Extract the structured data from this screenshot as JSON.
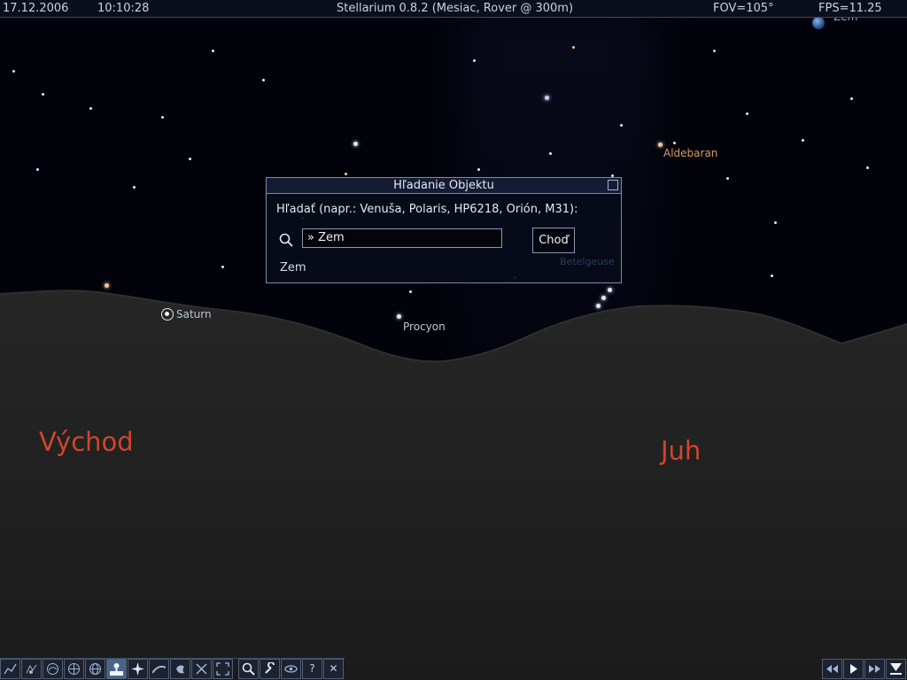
{
  "topbar": {
    "date": "17.12.2006",
    "time": "10:10:28",
    "title": "Stellarium 0.8.2 (Mesiac, Rover @ 300m)",
    "fov": "FOV=105°",
    "fps": "FPS=11.25"
  },
  "sky_labels": {
    "zem": "Zem",
    "aldebaran": "Aldebaran",
    "saturn": "Saturn",
    "procyon": "Procyon",
    "faded": "Betelgeuse"
  },
  "cardinals": {
    "east": "Východ",
    "south": "Juh"
  },
  "search_dialog": {
    "title": "Hľadanie Objektu",
    "hint": "Hľadať (napr.: Venuša, Polaris, HP6218, Orión, M31):",
    "input_value": "» Zem",
    "go_label": "Choď",
    "suggestion": "Zem"
  },
  "toolbar": {
    "left_icons": [
      "constellation-lines-icon",
      "constellation-art-icon",
      "constellation-names-icon",
      "azimuth-grid-icon",
      "equatorial-grid-icon",
      "ground-icon",
      "cardinal-points-icon",
      "atmosphere-icon",
      "nebula-icon",
      "equatorial-mount-icon",
      "center-on-selection-icon",
      "search-icon",
      "configuration-icon",
      "night-mode-icon",
      "help-icon",
      "quit-icon"
    ],
    "right_icons": [
      "rewind-icon",
      "play-icon",
      "fast-forward-icon",
      "real-time-icon"
    ],
    "help_glyph": "?",
    "quit_glyph": "✕",
    "colors": {
      "bar_bg": "#1c2230",
      "active": "#4a6486"
    }
  }
}
